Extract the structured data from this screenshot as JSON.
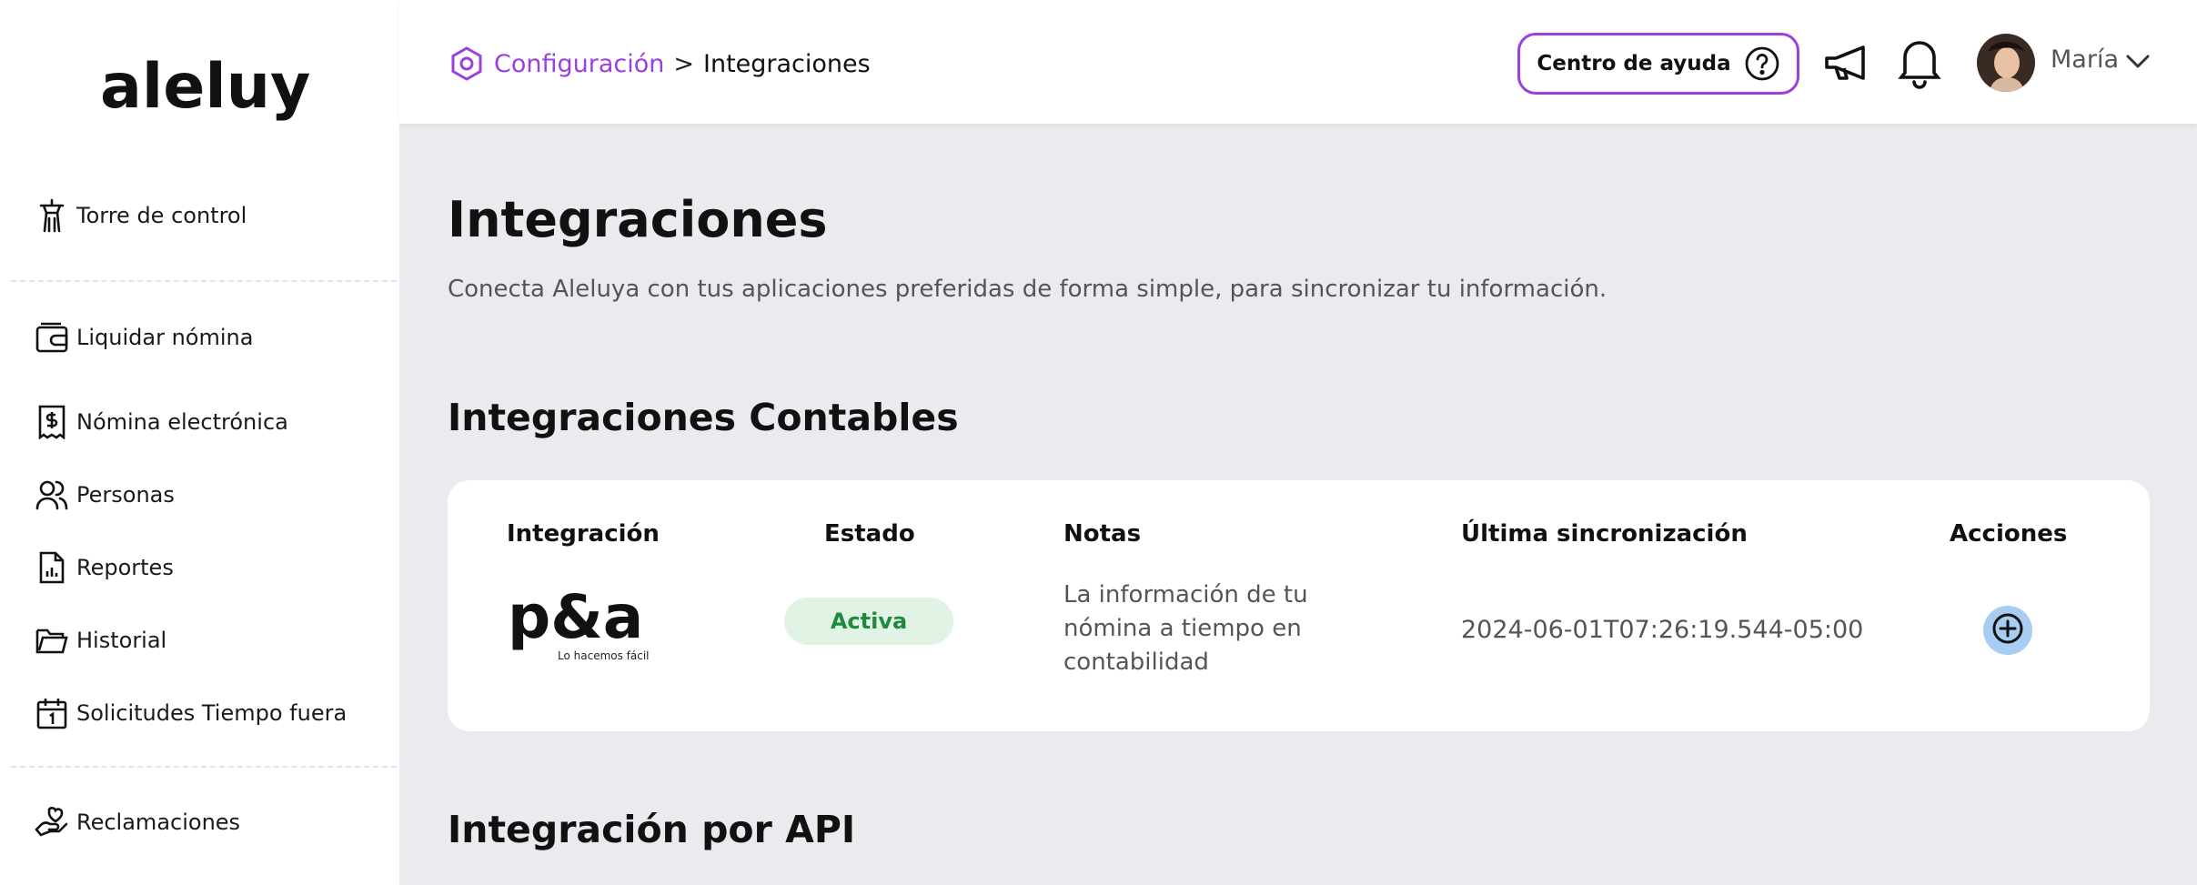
{
  "sidebar": {
    "logo_text": "aleluya",
    "items": [
      {
        "label": "Torre de control",
        "icon": "control-tower-icon"
      },
      {
        "label": "Liquidar nómina",
        "icon": "wallet-icon"
      },
      {
        "label": "Nómina electrónica",
        "icon": "dollar-receipt-icon"
      },
      {
        "label": "Personas",
        "icon": "people-icon"
      },
      {
        "label": "Reportes",
        "icon": "report-chart-icon"
      },
      {
        "label": "Historial",
        "icon": "folder-icon"
      },
      {
        "label": "Solicitudes Tiempo fuera",
        "icon": "calendar-icon"
      },
      {
        "label": "Reclamaciones",
        "icon": "hand-heart-icon"
      }
    ]
  },
  "header": {
    "breadcrumb": {
      "parent": "Configuración",
      "separator": ">",
      "current": "Integraciones"
    },
    "help_label": "Centro de ayuda",
    "user_name": "María"
  },
  "main": {
    "title": "Integraciones",
    "subtitle": "Conecta Aleluya con tus aplicaciones preferidas de forma simple, para sincronizar tu información.",
    "accounting_title": "Integraciones Contables",
    "table": {
      "headers": [
        "Integración",
        "Estado",
        "Notas",
        "Última sincronización",
        "Acciones"
      ],
      "rows": [
        {
          "integration_logo": "p&a",
          "integration_tagline": "Lo hacemos fácil",
          "status": "Activa",
          "notes": "La información de tu nómina a tiempo en contabilidad",
          "last_sync": "2024-06-01T07:26:19.544-05:00",
          "action_icon": "plus-circle-icon"
        }
      ]
    },
    "api_title": "Integración por API"
  },
  "colors": {
    "accent": "#9b3fe0",
    "status_active_bg": "#e1f3e4",
    "status_active_text": "#1e8a3c",
    "action_bg": "#a8cdf2",
    "page_bg": "#ebeaef"
  }
}
